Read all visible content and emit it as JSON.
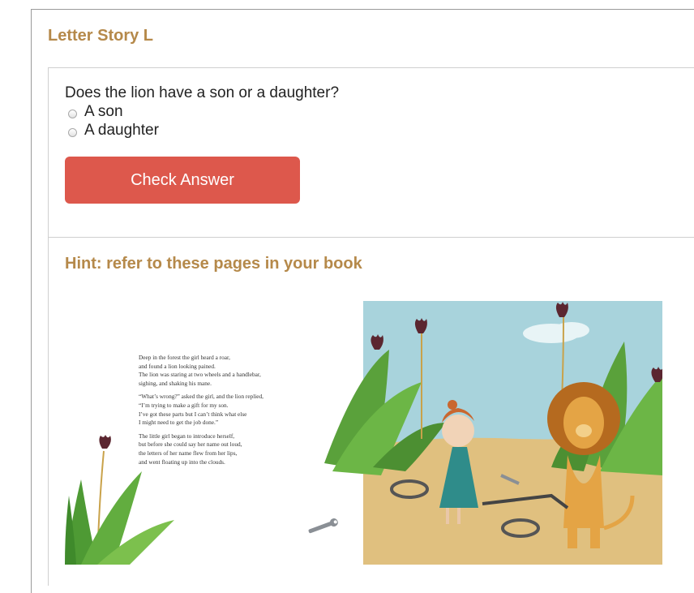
{
  "page": {
    "title": "Letter Story L"
  },
  "question": {
    "text": "Does the lion have a son or a daughter?",
    "options": [
      {
        "label": "A son",
        "selected": false
      },
      {
        "label": "A daughter",
        "selected": false
      }
    ],
    "check_button_label": "Check Answer"
  },
  "hint": {
    "title": "Hint: refer to these pages in your book",
    "illustration_icon": "lion-and-girl-illustration",
    "story_paragraphs": [
      {
        "lines": [
          "Deep in the forest the girl heard a roar,",
          "and found a lion looking pained.",
          "The lion was staring at two wheels and a handlebar,",
          "sighing, and shaking his mane."
        ]
      },
      {
        "lines": [
          "“What’s wrong?” asked the girl, and the lion replied,",
          "“I’m trying to make a gift for my son.",
          "I’ve got these parts but I can’t think what else",
          "I might need to get the job done.”"
        ]
      },
      {
        "lines": [
          "The little girl began to introduce herself,",
          "but before she could say her name out loud,",
          "the letters of her name flew from her lips,",
          "and went floating up into the clouds."
        ]
      }
    ]
  },
  "colors": {
    "accent_title": "#b5894a",
    "button_bg": "#dd584c",
    "button_text": "#ffffff",
    "sky": "#a8d3dc",
    "ground": "#e0c07f",
    "leaves": "#5aa13b"
  }
}
